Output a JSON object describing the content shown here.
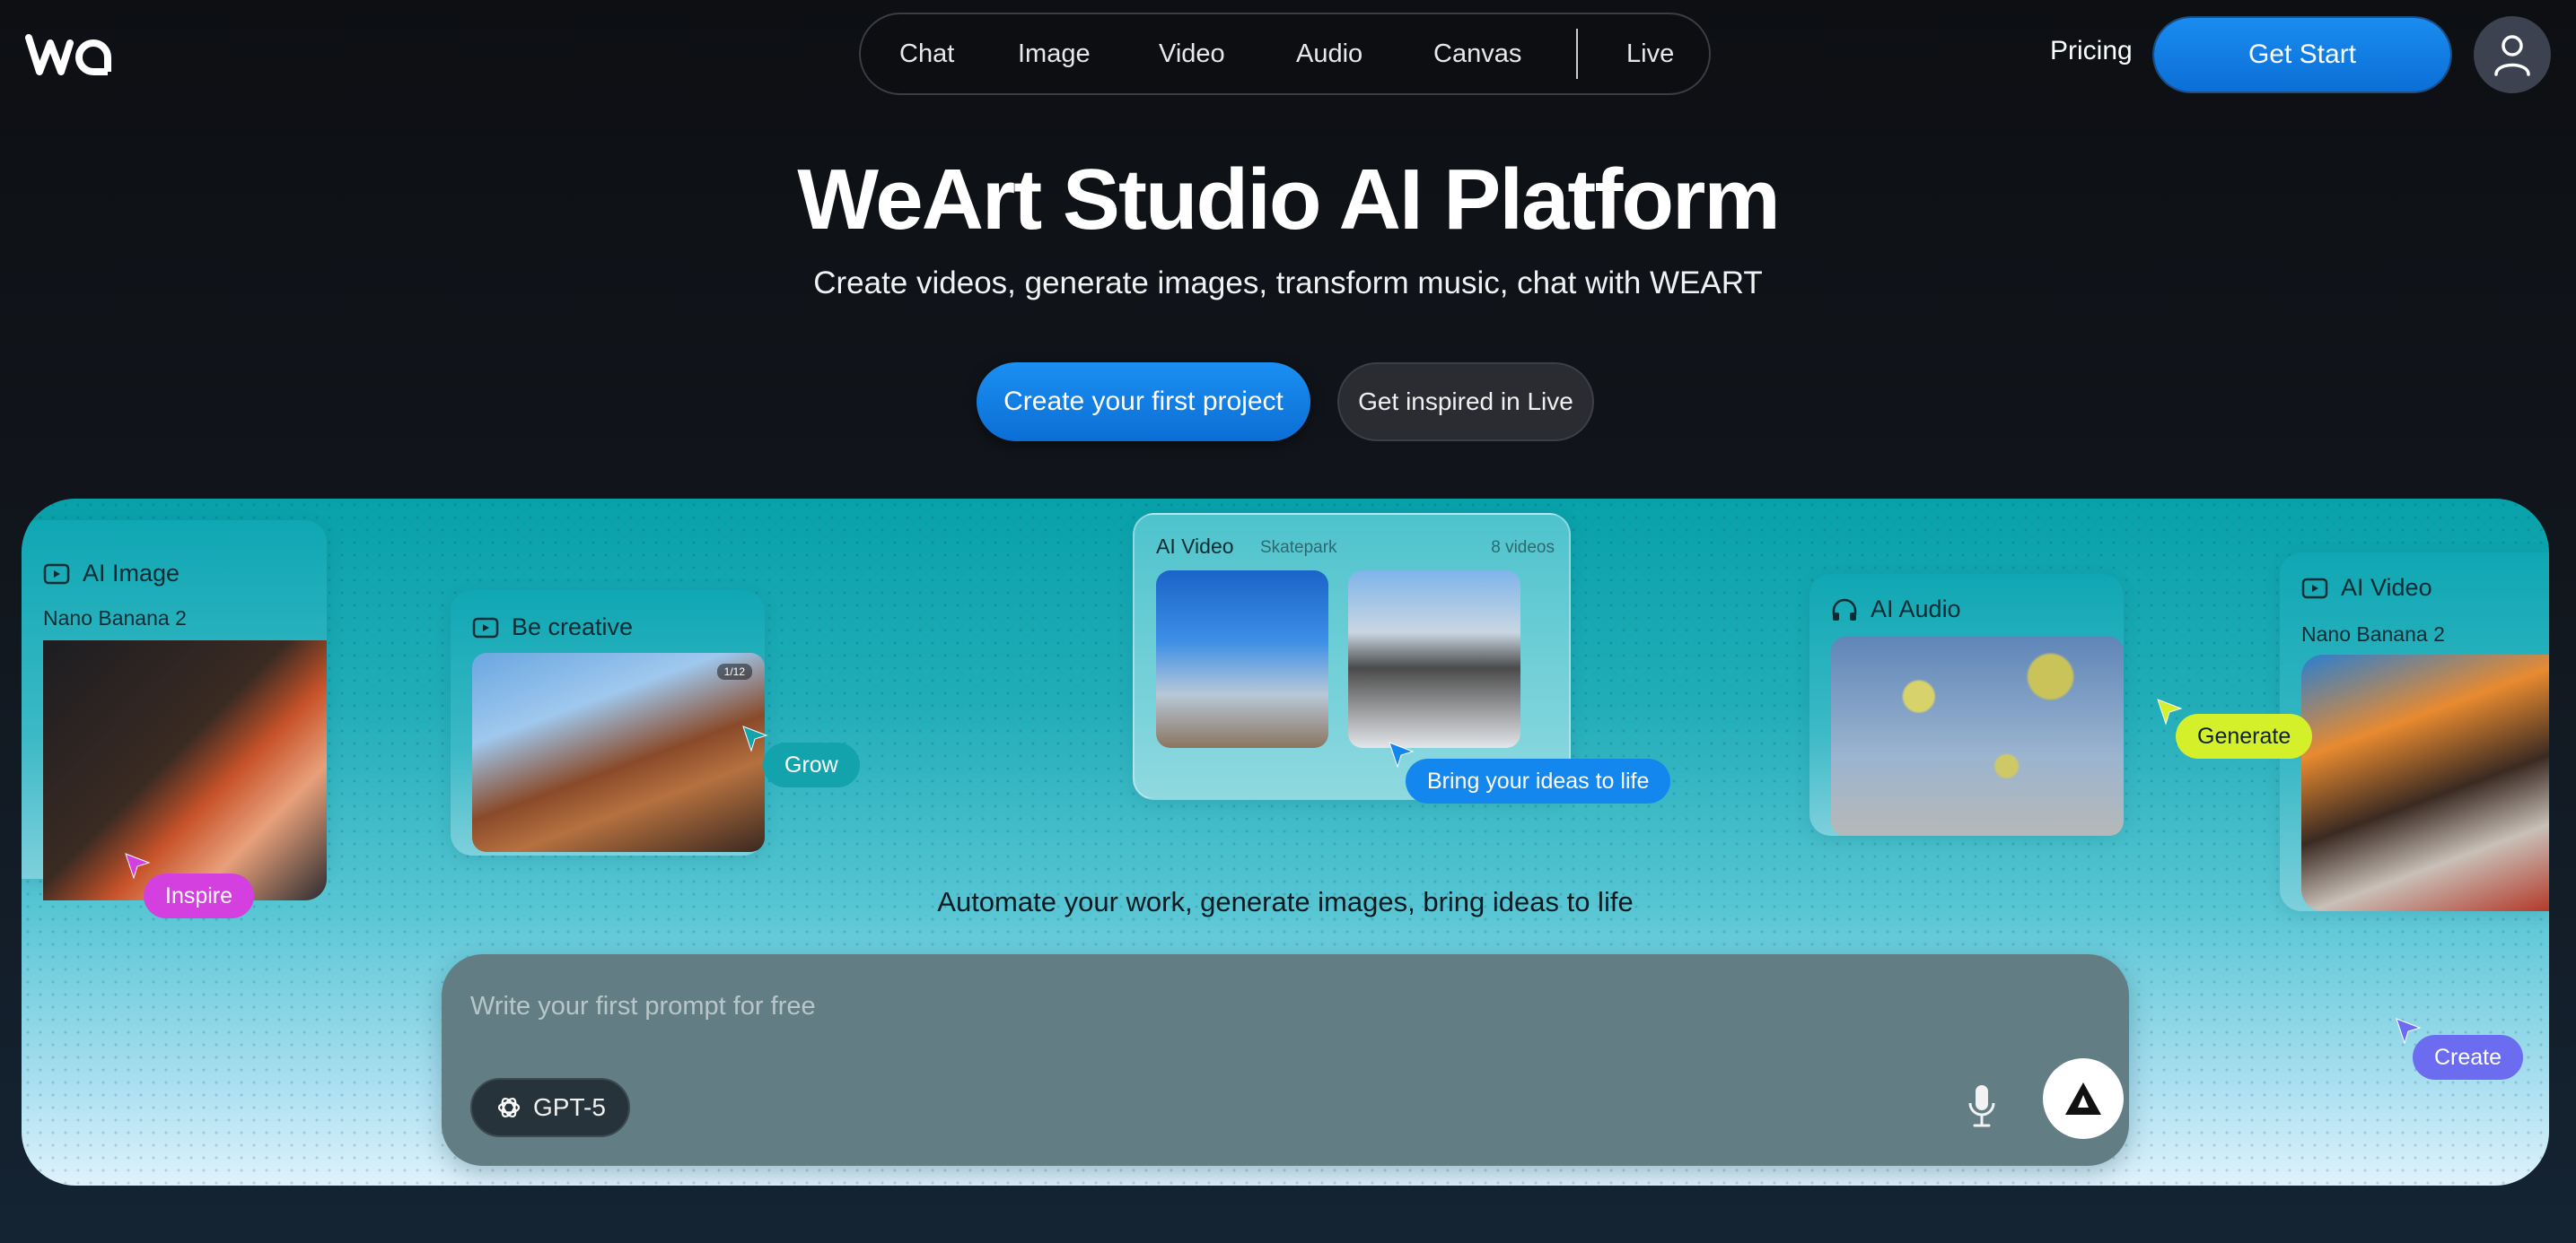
{
  "brand": {
    "logo_icon": "weart-logo-icon"
  },
  "nav": {
    "items": [
      {
        "label": "Chat"
      },
      {
        "label": "Image"
      },
      {
        "label": "Video"
      },
      {
        "label": "Audio"
      },
      {
        "label": "Canvas"
      },
      {
        "label": "Live"
      }
    ]
  },
  "header": {
    "pricing_label": "Pricing",
    "get_start_label": "Get Start",
    "user_icon": "user-icon"
  },
  "hero": {
    "title": "WeArt Studio AI Platform",
    "subtitle": "Create videos, generate images, transform music, chat with WEART",
    "primary_cta": "Create your first project",
    "secondary_cta": "Get inspired in Live"
  },
  "showcase": {
    "cards": {
      "ai_image": {
        "title": "AI Image",
        "model": "Nano Banana 2",
        "icon": "video-frame-icon"
      },
      "be_creative": {
        "title": "Be creative",
        "counter": "1/12",
        "icon": "video-frame-icon"
      },
      "ai_video_center": {
        "title": "AI Video",
        "subtitle": "Skatepark",
        "count": "8 videos"
      },
      "ai_audio": {
        "title": "AI Audio",
        "icon": "headphones-icon"
      },
      "ai_video_right": {
        "title": "AI Video",
        "model": "Nano Banana 2",
        "icon": "video-frame-icon"
      }
    },
    "tags": {
      "inspire": "Inspire",
      "grow": "Grow",
      "bring": "Bring your ideas to life",
      "generate": "Generate",
      "create": "Create"
    },
    "colors": {
      "inspire": "#d43fe0",
      "grow": "#12a3ad",
      "bring": "#1487ef",
      "generate": "#d4f02a",
      "create": "#6b6cf0"
    },
    "tagline": "Automate your work, generate images, bring ideas to life"
  },
  "prompt": {
    "placeholder": "Write your first prompt for free",
    "value": "",
    "model_label": "GPT-5",
    "model_icon": "openai-icon",
    "mic_icon": "microphone-icon",
    "send_icon": "weart-send-icon"
  }
}
